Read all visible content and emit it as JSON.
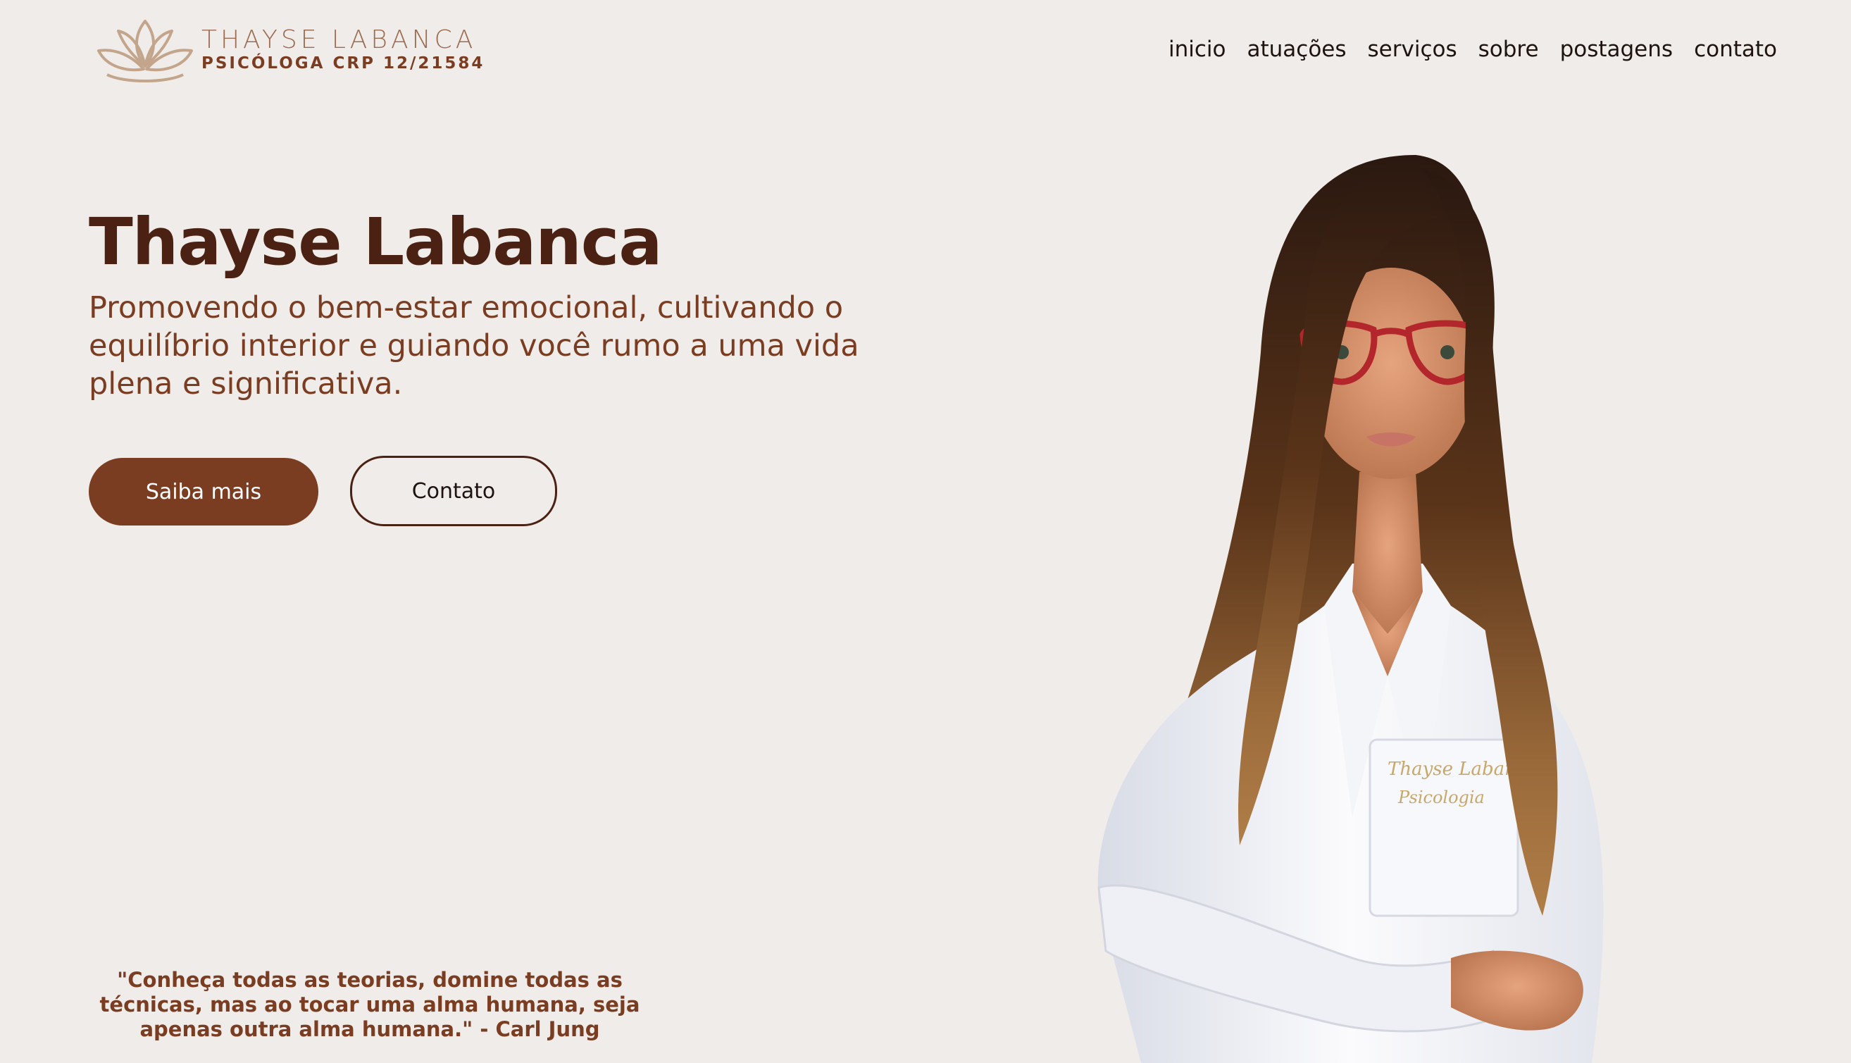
{
  "brand": {
    "name": "THAYSE LABANCA",
    "subtitle": "PSICÓLOGA CRP 12/21584",
    "logo_icon": "lotus-icon"
  },
  "nav": {
    "items": [
      {
        "label": "inicio"
      },
      {
        "label": "atuações"
      },
      {
        "label": "serviços"
      },
      {
        "label": "sobre"
      },
      {
        "label": "postagens"
      },
      {
        "label": "contato"
      }
    ]
  },
  "hero": {
    "title": "Thayse Labanca",
    "subtitle": "Promovendo o bem-estar emocional, cultivando o equilíbrio interior e guiando você rumo a uma vida plena e significativa.",
    "primary_button": "Saiba mais",
    "secondary_button": "Contato",
    "quote": "\"Conheça todas as teorias, domine todas as técnicas, mas ao tocar uma alma humana, seja apenas outra alma humana.\" - Carl Jung"
  },
  "portrait": {
    "coat_embroidery_line1": "Thayse Labanca",
    "coat_embroidery_line2": "Psicologia"
  },
  "colors": {
    "background": "#F0ECE9",
    "primary": "#7A3D22",
    "title": "#4A2113",
    "logo_gold": "#C3A58C"
  }
}
